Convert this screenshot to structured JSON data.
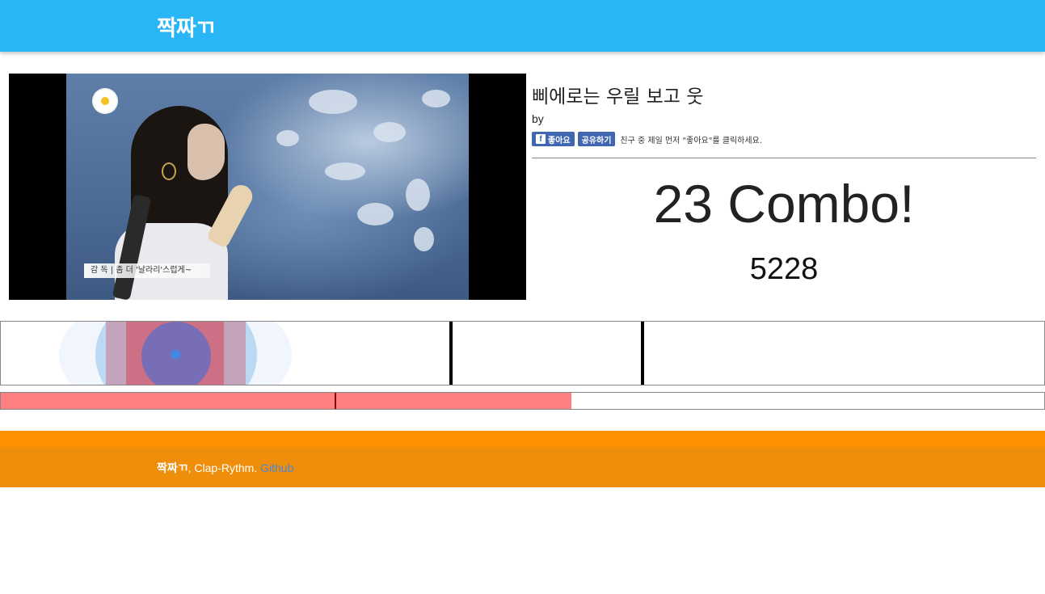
{
  "header": {
    "brand": "짝짜ㄲ"
  },
  "video": {
    "subtitle": "감 독 | 좀 더 '날라리'스럽게~"
  },
  "song": {
    "title": "삐에로는 우릴 보고 웃",
    "by": "by"
  },
  "facebook": {
    "like_label": "좋아요",
    "share_label": "공유하기",
    "note": "친구 중 제일 먼저 \"좋아요\"를 클릭하세요.",
    "icon": "facebook-icon",
    "color": "#4267b2"
  },
  "game": {
    "combo": "23 Combo!",
    "score": "5228"
  },
  "progress": {
    "fraction": 0.547,
    "marker_fraction": 0.32,
    "fill_color": "#ff8080"
  },
  "footer": {
    "brand": "짝짜ㄲ",
    "text": ", Clap-Rythm. ",
    "link": "Github"
  },
  "colors": {
    "header": "#29b6f6",
    "footer": "#ef8e0a",
    "footer_top": "#ff9100"
  }
}
